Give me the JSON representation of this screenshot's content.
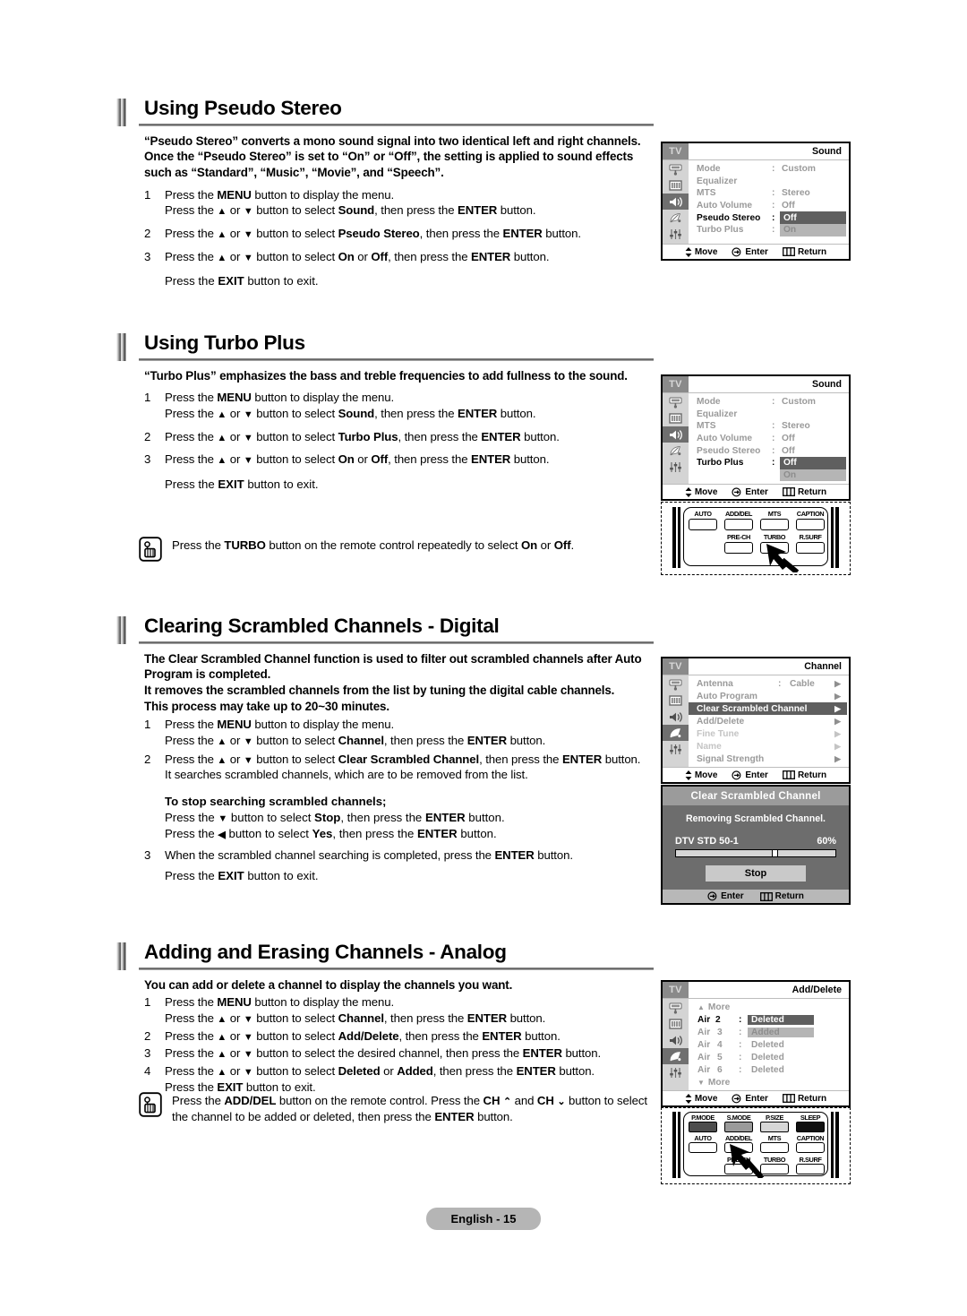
{
  "page": {
    "footer": "English - 15"
  },
  "sections": [
    {
      "title": "Using Pseudo Stereo",
      "intro": "“Pseudo Stereo” converts a mono sound signal into two identical left and right channels. Once the “Pseudo Stereo” is set to “On” or “Off”, the setting is applied to sound effects such as “Standard”, “Music”, “Movie”, and “Speech”.",
      "steps": [
        {
          "num": "1",
          "lines": [
            "Press the MENU button to display the menu.",
            "Press the ▲ or ▼ button to select Sound, then press the ENTER button."
          ]
        },
        {
          "num": "2",
          "lines": [
            "Press the ▲ or ▼ button to select Pseudo Stereo, then press the ENTER button."
          ]
        },
        {
          "num": "3",
          "lines": [
            "Press the ▲ or ▼ button to select On or Off, then press the ENTER button."
          ]
        }
      ],
      "exit": "Press the EXIT button to exit."
    },
    {
      "title": "Using Turbo Plus",
      "intro": "“Turbo Plus” emphasizes the bass and treble frequencies to add fullness to the sound.",
      "steps": [
        {
          "num": "1",
          "lines": [
            "Press the MENU button to display the menu.",
            "Press the ▲ or ▼ button to select Sound, then press the ENTER button."
          ]
        },
        {
          "num": "2",
          "lines": [
            "Press the ▲ or ▼ button to select Turbo Plus, then press the ENTER button."
          ]
        },
        {
          "num": "3",
          "lines": [
            "Press the ▲ or ▼ button to select On or Off, then press the ENTER button."
          ]
        }
      ],
      "exit": "Press the EXIT button to exit.",
      "tip": "Press the TURBO button on the remote control repeatedly to select On or Off."
    },
    {
      "title": "Clearing Scrambled Channels - Digital",
      "intro_lines": [
        "The Clear Scrambled Channel function is used to filter out scrambled channels after Auto",
        "Program is completed.",
        "It removes the scrambled channels from the list by tuning the digital cable channels.",
        "This process may take up to 20~30 minutes."
      ],
      "steps": [
        {
          "num": "1",
          "lines": [
            "Press the MENU button to display the menu.",
            "Press the ▲ or ▼ button to select Channel, then press the ENTER button."
          ]
        },
        {
          "num": "2",
          "lines": [
            "Press the ▲ or ▼ button to select Clear Scrambled Channel, then press the ENTER button.",
            "It searches scrambled channels, which are to be removed from the list."
          ]
        },
        {
          "num": "3",
          "lines": [
            "When the scrambled channel searching is completed, press the ENTER button."
          ]
        }
      ],
      "stop_note": {
        "heading": "To stop searching scrambled channels;",
        "lines": [
          "Press the ▼ button to select Stop, then press the ENTER button.",
          "Press the ◀ button to select Yes, then press the  ENTER button."
        ]
      },
      "exit": "Press the EXIT button to exit."
    },
    {
      "title": "Adding and Erasing Channels - Analog",
      "intro": "You can add or delete a channel to display the channels you want.",
      "steps": [
        {
          "num": "1",
          "lines": [
            "Press the MENU button to display the menu.",
            "Press the ▲ or ▼ button to select Channel, then press the ENTER button."
          ]
        },
        {
          "num": "2",
          "lines": [
            "Press the ▲ or ▼ button to select Add/Delete, then press the ENTER button."
          ]
        },
        {
          "num": "3",
          "lines": [
            "Press the ▲ or ▼ button to select the desired channel, then press the ENTER button."
          ]
        },
        {
          "num": "4",
          "lines": [
            "Press the ▲ or ▼ button to select Deleted or Added, then press the ENTER button."
          ]
        }
      ],
      "exit": "Press the EXIT button to exit.",
      "tip_lines": [
        "Press the ADD/DEL button on the remote control. Press the CH ⌃ and CH ⌄ button to",
        "select the channel to be added or deleted, then press the ENTER button."
      ]
    }
  ],
  "osd_common": {
    "tv_label": "TV",
    "footer": {
      "move": "Move",
      "enter": "Enter",
      "return": "Return"
    }
  },
  "osd_sound_pseudo": {
    "title": "Sound",
    "rows": [
      {
        "label": "Mode",
        "colon": ":",
        "value": "Custom"
      },
      {
        "label": "Equalizer",
        "colon": "",
        "value": ""
      },
      {
        "label": "MTS",
        "colon": ":",
        "value": "Stereo"
      },
      {
        "label": "Auto Volume",
        "colon": ":",
        "value": "Off"
      },
      {
        "label": "Pseudo Stereo",
        "colon": ":",
        "value": "Off"
      },
      {
        "label": "Turbo Plus",
        "colon": ":",
        "value": "On"
      }
    ]
  },
  "osd_sound_turbo": {
    "title": "Sound",
    "rows": [
      {
        "label": "Mode",
        "colon": ":",
        "value": "Custom"
      },
      {
        "label": "Equalizer",
        "colon": "",
        "value": ""
      },
      {
        "label": "MTS",
        "colon": ":",
        "value": "Stereo"
      },
      {
        "label": "Auto Volume",
        "colon": ":",
        "value": "Off"
      },
      {
        "label": "Pseudo Stereo",
        "colon": ":",
        "value": "Off"
      },
      {
        "label": "Turbo Plus",
        "colon": ":",
        "value": "Off"
      },
      {
        "label": "",
        "colon": "",
        "value": "On"
      }
    ]
  },
  "osd_channel": {
    "title": "Channel",
    "rows": [
      {
        "label": "Antenna",
        "colon": ":",
        "value": "Cable"
      },
      {
        "label": "Auto Program",
        "colon": "",
        "value": ""
      },
      {
        "label": "Clear Scrambled Channel",
        "colon": "",
        "value": ""
      },
      {
        "label": "Add/Delete",
        "colon": "",
        "value": ""
      },
      {
        "label": "Fine Tune",
        "colon": "",
        "value": ""
      },
      {
        "label": "Name",
        "colon": "",
        "value": ""
      },
      {
        "label": "Signal Strength",
        "colon": "",
        "value": ""
      }
    ]
  },
  "osd_add_delete": {
    "title": "Add/Delete",
    "more_up": "More",
    "more_down": "More",
    "rows": [
      {
        "label": "Air",
        "num": "2",
        "colon": ":",
        "value": "Deleted"
      },
      {
        "label": "Air",
        "num": "3",
        "colon": ":",
        "value": "Added"
      },
      {
        "label": "Air",
        "num": "4",
        "colon": ":",
        "value": "Deleted"
      },
      {
        "label": "Air",
        "num": "5",
        "colon": ":",
        "value": "Deleted"
      },
      {
        "label": "Air",
        "num": "6",
        "colon": ":",
        "value": "Deleted"
      }
    ]
  },
  "dialog_clear": {
    "title": "Clear Scrambled Channel",
    "message": "Removing Scrambled Channel.",
    "channel": "DTV STD 50-1",
    "percent": "60%",
    "progress": 60,
    "button": "Stop",
    "footer": {
      "enter": "Enter",
      "return": "Return"
    }
  },
  "remote_turbo": {
    "row1": [
      "AUTO PROG.",
      "ADD/DEL",
      "MTS",
      "CAPTION"
    ],
    "row2": [
      "PRE-CH",
      "TURBO",
      "R.SURF"
    ]
  },
  "remote_adddel": {
    "row0": [
      "P.MODE",
      "S.MODE",
      "P.SIZE",
      "SLEEP"
    ],
    "row0_colors": [
      "#4d4d4d",
      "#9a9a9a",
      "#d6d6d6",
      "#111111"
    ],
    "row1": [
      "AUTO PROG.",
      "ADD/DEL",
      "MTS",
      "CAPTION"
    ],
    "row2": [
      "PRE-CH",
      "TURBO",
      "R.SURF"
    ]
  }
}
